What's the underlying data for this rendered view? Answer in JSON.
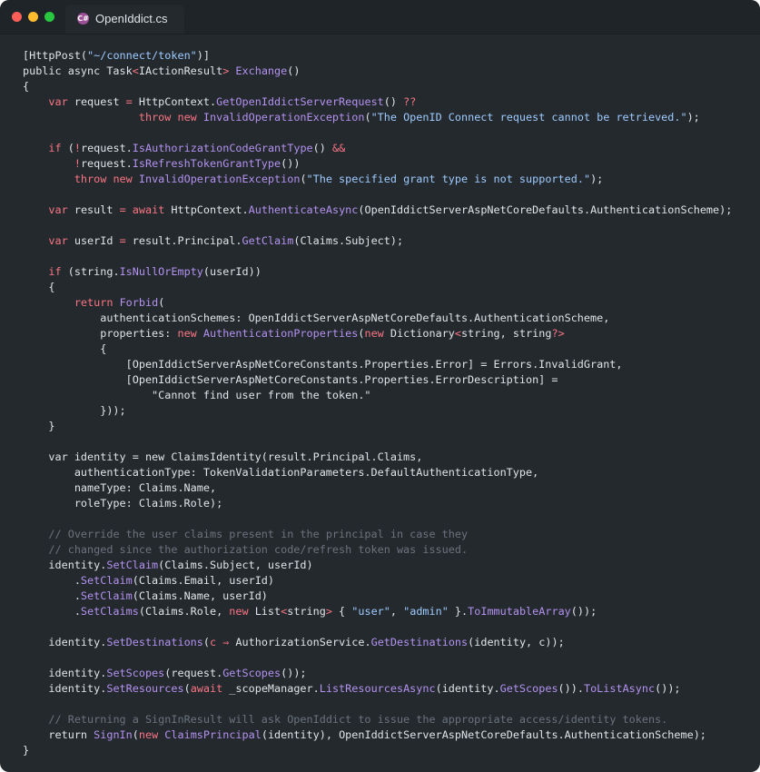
{
  "window": {
    "tab_title": "OpenIddict.cs",
    "tab_icon": "csharp-file-icon",
    "controls": [
      "close",
      "minimize",
      "zoom"
    ]
  },
  "colors": {
    "background": "#24292e",
    "keyword": "#f97583",
    "function": "#b392f0",
    "string": "#9ecbff",
    "comment": "#6a737d",
    "text": "#e1e4e8"
  },
  "code": {
    "lines": [
      [
        [
          "p",
          "[HttpPost("
        ],
        [
          "s",
          "\"~/connect/token\""
        ],
        [
          "p",
          ")]"
        ]
      ],
      [
        [
          "p",
          "public async Task"
        ],
        [
          "k",
          "<"
        ],
        [
          "p",
          "IActionResult"
        ],
        [
          "k",
          ">"
        ],
        [
          "p",
          " "
        ],
        [
          "f",
          "Exchange"
        ],
        [
          "p",
          "()"
        ]
      ],
      [
        [
          "p",
          "{"
        ]
      ],
      [
        [
          "p",
          "    "
        ],
        [
          "k",
          "var"
        ],
        [
          "p",
          " request "
        ],
        [
          "k",
          "="
        ],
        [
          "p",
          " HttpContext."
        ],
        [
          "f",
          "GetOpenIddictServerRequest"
        ],
        [
          "p",
          "() "
        ],
        [
          "k",
          "??"
        ]
      ],
      [
        [
          "p",
          "                  "
        ],
        [
          "k",
          "throw"
        ],
        [
          "p",
          " "
        ],
        [
          "k",
          "new"
        ],
        [
          "p",
          " "
        ],
        [
          "f",
          "InvalidOperationException"
        ],
        [
          "p",
          "("
        ],
        [
          "s",
          "\"The OpenID Connect request cannot be retrieved.\""
        ],
        [
          "p",
          ");"
        ]
      ],
      [],
      [
        [
          "p",
          "    "
        ],
        [
          "k",
          "if"
        ],
        [
          "p",
          " ("
        ],
        [
          "k",
          "!"
        ],
        [
          "p",
          "request."
        ],
        [
          "f",
          "IsAuthorizationCodeGrantType"
        ],
        [
          "p",
          "() "
        ],
        [
          "k",
          "&&"
        ]
      ],
      [
        [
          "p",
          "        "
        ],
        [
          "k",
          "!"
        ],
        [
          "p",
          "request."
        ],
        [
          "f",
          "IsRefreshTokenGrantType"
        ],
        [
          "p",
          "())"
        ]
      ],
      [
        [
          "p",
          "        "
        ],
        [
          "k",
          "throw"
        ],
        [
          "p",
          " "
        ],
        [
          "k",
          "new"
        ],
        [
          "p",
          " "
        ],
        [
          "f",
          "InvalidOperationException"
        ],
        [
          "p",
          "("
        ],
        [
          "s",
          "\"The specified grant type is not supported.\""
        ],
        [
          "p",
          ");"
        ]
      ],
      [],
      [
        [
          "p",
          "    "
        ],
        [
          "k",
          "var"
        ],
        [
          "p",
          " result "
        ],
        [
          "k",
          "="
        ],
        [
          "p",
          " "
        ],
        [
          "k",
          "await"
        ],
        [
          "p",
          " HttpContext."
        ],
        [
          "f",
          "AuthenticateAsync"
        ],
        [
          "p",
          "(OpenIddictServerAspNetCoreDefaults.AuthenticationScheme);"
        ]
      ],
      [],
      [
        [
          "p",
          "    "
        ],
        [
          "k",
          "var"
        ],
        [
          "p",
          " userId "
        ],
        [
          "k",
          "="
        ],
        [
          "p",
          " result.Principal."
        ],
        [
          "f",
          "GetClaim"
        ],
        [
          "p",
          "(Claims.Subject);"
        ]
      ],
      [],
      [
        [
          "p",
          "    "
        ],
        [
          "k",
          "if"
        ],
        [
          "p",
          " (string."
        ],
        [
          "f",
          "IsNullOrEmpty"
        ],
        [
          "p",
          "(userId))"
        ]
      ],
      [
        [
          "p",
          "    {"
        ]
      ],
      [
        [
          "p",
          "        "
        ],
        [
          "k",
          "return"
        ],
        [
          "p",
          " "
        ],
        [
          "f",
          "Forbid"
        ],
        [
          "p",
          "("
        ]
      ],
      [
        [
          "p",
          "            authenticationSchemes: OpenIddictServerAspNetCoreDefaults.AuthenticationScheme,"
        ]
      ],
      [
        [
          "p",
          "            properties: "
        ],
        [
          "k",
          "new"
        ],
        [
          "p",
          " "
        ],
        [
          "f",
          "AuthenticationProperties"
        ],
        [
          "p",
          "("
        ],
        [
          "k",
          "new"
        ],
        [
          "p",
          " Dictionary"
        ],
        [
          "k",
          "<"
        ],
        [
          "p",
          "string, string"
        ],
        [
          "k",
          "?>"
        ]
      ],
      [
        [
          "p",
          "            {"
        ]
      ],
      [
        [
          "p",
          "                [OpenIddictServerAspNetCoreConstants.Properties.Error] = Errors.InvalidGrant,"
        ]
      ],
      [
        [
          "p",
          "                [OpenIddictServerAspNetCoreConstants.Properties.ErrorDescription] ="
        ]
      ],
      [
        [
          "p",
          "                    \"Cannot find user from the token.\""
        ]
      ],
      [
        [
          "p",
          "            }));"
        ]
      ],
      [
        [
          "p",
          "    }"
        ]
      ],
      [],
      [
        [
          "p",
          "    var identity = new ClaimsIdentity(result.Principal.Claims,"
        ]
      ],
      [
        [
          "p",
          "        authenticationType: TokenValidationParameters.DefaultAuthenticationType,"
        ]
      ],
      [
        [
          "p",
          "        nameType: Claims.Name,"
        ]
      ],
      [
        [
          "p",
          "        roleType: Claims.Role);"
        ]
      ],
      [],
      [
        [
          "p",
          "    "
        ],
        [
          "c",
          "// Override the user claims present in the principal in case they"
        ]
      ],
      [
        [
          "p",
          "    "
        ],
        [
          "c",
          "// changed since the authorization code/refresh token was issued."
        ]
      ],
      [
        [
          "p",
          "    identity."
        ],
        [
          "f",
          "SetClaim"
        ],
        [
          "p",
          "(Claims.Subject, userId)"
        ]
      ],
      [
        [
          "p",
          "        ."
        ],
        [
          "f",
          "SetClaim"
        ],
        [
          "p",
          "(Claims.Email, userId)"
        ]
      ],
      [
        [
          "p",
          "        ."
        ],
        [
          "f",
          "SetClaim"
        ],
        [
          "p",
          "(Claims.Name, userId)"
        ]
      ],
      [
        [
          "p",
          "        ."
        ],
        [
          "f",
          "SetClaims"
        ],
        [
          "p",
          "(Claims.Role, "
        ],
        [
          "k",
          "new"
        ],
        [
          "p",
          " List"
        ],
        [
          "k",
          "<"
        ],
        [
          "p",
          "string"
        ],
        [
          "k",
          ">"
        ],
        [
          "p",
          " { "
        ],
        [
          "s",
          "\"user\""
        ],
        [
          "p",
          ", "
        ],
        [
          "s",
          "\"admin\""
        ],
        [
          "p",
          " }."
        ],
        [
          "f",
          "ToImmutableArray"
        ],
        [
          "p",
          "());"
        ]
      ],
      [],
      [
        [
          "p",
          "    identity."
        ],
        [
          "f",
          "SetDestinations"
        ],
        [
          "p",
          "("
        ],
        [
          "k",
          "c"
        ],
        [
          "p",
          " "
        ],
        [
          "k",
          "⇒"
        ],
        [
          "p",
          " AuthorizationService."
        ],
        [
          "f",
          "GetDestinations"
        ],
        [
          "p",
          "(identity, c));"
        ]
      ],
      [],
      [
        [
          "p",
          "    identity."
        ],
        [
          "f",
          "SetScopes"
        ],
        [
          "p",
          "(request."
        ],
        [
          "f",
          "GetScopes"
        ],
        [
          "p",
          "());"
        ]
      ],
      [
        [
          "p",
          "    identity."
        ],
        [
          "f",
          "SetResources"
        ],
        [
          "p",
          "("
        ],
        [
          "k",
          "await"
        ],
        [
          "p",
          " _scopeManager."
        ],
        [
          "f",
          "ListResourcesAsync"
        ],
        [
          "p",
          "(identity."
        ],
        [
          "f",
          "GetScopes"
        ],
        [
          "p",
          "())."
        ],
        [
          "f",
          "ToListAsync"
        ],
        [
          "p",
          "());"
        ]
      ],
      [],
      [
        [
          "p",
          "    "
        ],
        [
          "c",
          "// Returning a SignInResult will ask OpenIddict to issue the appropriate access/identity tokens."
        ]
      ],
      [
        [
          "p",
          "    return "
        ],
        [
          "f",
          "SignIn"
        ],
        [
          "p",
          "("
        ],
        [
          "k",
          "new"
        ],
        [
          "p",
          " "
        ],
        [
          "f",
          "ClaimsPrincipal"
        ],
        [
          "p",
          "(identity), OpenIddictServerAspNetCoreDefaults.AuthenticationScheme);"
        ]
      ],
      [
        [
          "p",
          "}"
        ]
      ]
    ]
  }
}
